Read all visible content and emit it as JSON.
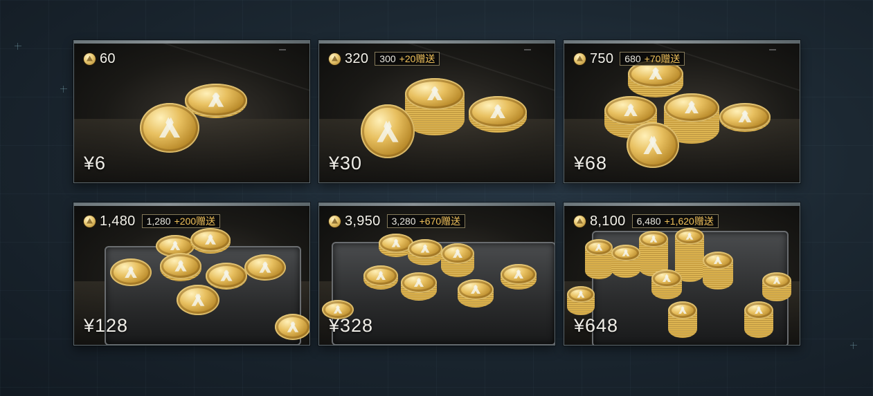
{
  "currency_icon": "gold-coin-icon",
  "colors": {
    "bonus_accent": "#f0c15a",
    "text": "#f4f2ea",
    "frame": "#5e6a70"
  },
  "packs": [
    {
      "amount": "60",
      "bonus_base": "",
      "bonus_extra": "",
      "price": "¥6"
    },
    {
      "amount": "320",
      "bonus_base": "300",
      "bonus_extra": "+20赠送",
      "price": "¥30"
    },
    {
      "amount": "750",
      "bonus_base": "680",
      "bonus_extra": "+70赠送",
      "price": "¥68"
    },
    {
      "amount": "1,480",
      "bonus_base": "1,280",
      "bonus_extra": "+200赠送",
      "price": "¥128"
    },
    {
      "amount": "3,950",
      "bonus_base": "3,280",
      "bonus_extra": "+670赠送",
      "price": "¥328"
    },
    {
      "amount": "8,100",
      "bonus_base": "6,480",
      "bonus_extra": "+1,620赠送",
      "price": "¥648"
    }
  ]
}
